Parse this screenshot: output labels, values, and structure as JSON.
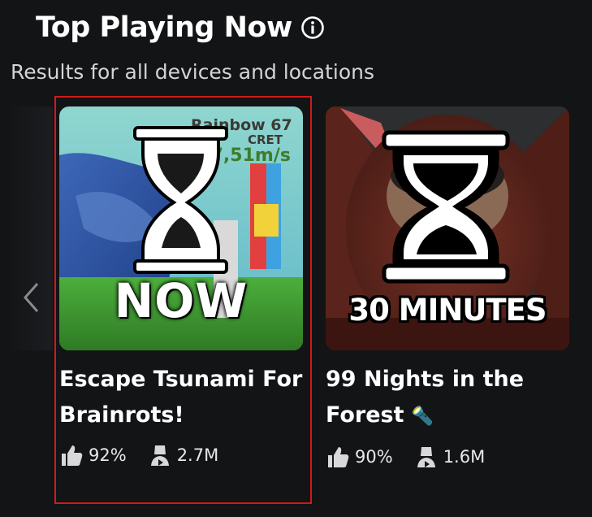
{
  "header": {
    "title": "Top Playing Now",
    "subtitle": "Results for all devices and locations"
  },
  "games": [
    {
      "name": "Escape Tsunami For Brainrots!",
      "overlay_text": "NOW",
      "thumbnail_text": [
        "Rainbow 67",
        "CRET",
        "$67,51m/s"
      ],
      "rating": "92%",
      "players": "2.7M"
    },
    {
      "name": "99 Nights in the Forest",
      "name_emoji": "🔦",
      "overlay_text": "30 MINUTES",
      "rating": "90%",
      "players": "1.6M"
    }
  ],
  "icons": {
    "info": "info-icon",
    "prev": "chevron-left-icon",
    "rating": "thumbs-up-icon",
    "players": "player-icon",
    "overlay": "hourglass-icon"
  },
  "colors": {
    "background": "#131416",
    "highlight": "#d11a1a"
  }
}
